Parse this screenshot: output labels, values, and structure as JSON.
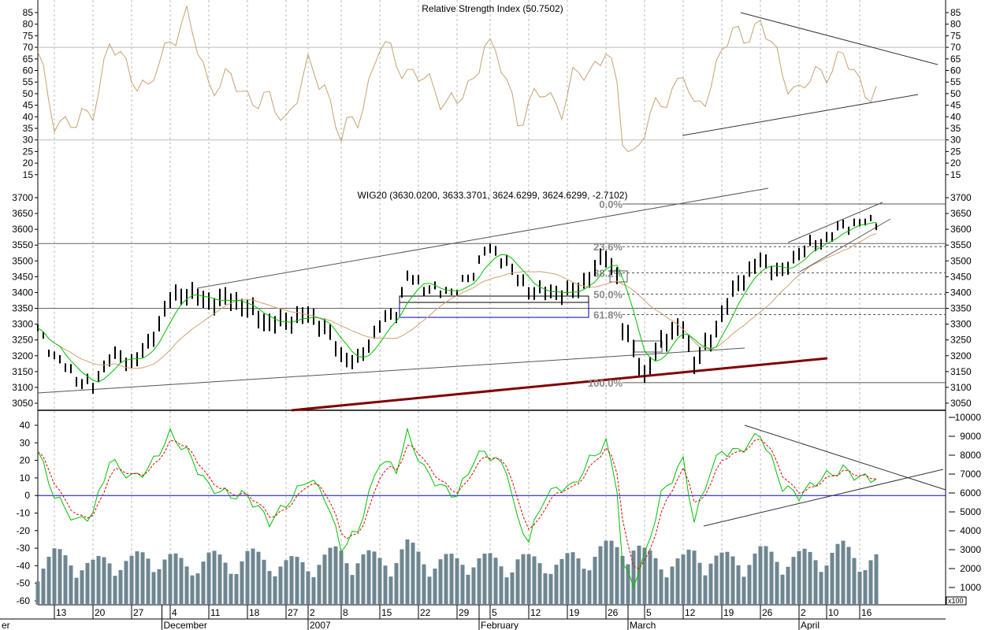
{
  "chart_data": [
    {
      "type": "line",
      "title": "Relative Strength Index (50.7502)",
      "yticks": [
        85,
        80,
        75,
        70,
        65,
        60,
        55,
        50,
        45,
        40,
        35,
        30,
        25,
        20,
        15
      ],
      "ylim": [
        12,
        88
      ],
      "levels": [
        70,
        30
      ],
      "days": [
        0,
        3,
        7,
        10,
        13,
        17,
        20,
        24,
        27,
        31,
        35,
        38,
        42,
        45,
        49,
        52,
        55,
        58,
        62,
        65,
        67,
        70,
        73,
        76,
        79,
        81,
        85,
        87,
        89,
        92,
        95,
        97,
        100,
        103,
        105,
        106,
        108,
        110,
        113,
        117,
        119,
        122,
        124,
        127,
        131,
        135,
        138,
        142,
        146,
        149,
        152
      ],
      "values": [
        65,
        40,
        35,
        45,
        70,
        60,
        50,
        75,
        82,
        55,
        55,
        50,
        45,
        40,
        60,
        55,
        30,
        40,
        70,
        65,
        60,
        55,
        50,
        45,
        55,
        75,
        55,
        40,
        45,
        50,
        45,
        55,
        60,
        70,
        50,
        30,
        25,
        35,
        45,
        60,
        40,
        55,
        70,
        75,
        80,
        60,
        50,
        60,
        65,
        55,
        50
      ],
      "color": "#c8a070"
    },
    {
      "type": "line",
      "title": "WIG20 (3630.0200, 3633.3701, 3624.6299, 3624.6299, -2.7102)",
      "yticks": [
        3700,
        3650,
        3600,
        3550,
        3500,
        3450,
        3400,
        3350,
        3300,
        3250,
        3200,
        3150,
        3100,
        3050
      ],
      "ylim": [
        3030,
        3720
      ],
      "days": [
        0,
        3,
        7,
        10,
        13,
        17,
        20,
        24,
        27,
        31,
        35,
        38,
        42,
        45,
        49,
        52,
        55,
        58,
        62,
        65,
        67,
        70,
        73,
        76,
        79,
        81,
        85,
        87,
        89,
        92,
        95,
        97,
        100,
        103,
        105,
        106,
        108,
        110,
        113,
        117,
        119,
        122,
        124,
        127,
        131,
        135,
        138,
        142,
        146,
        149,
        152
      ],
      "close": [
        3280,
        3200,
        3130,
        3100,
        3200,
        3180,
        3230,
        3380,
        3400,
        3370,
        3380,
        3350,
        3300,
        3310,
        3330,
        3290,
        3200,
        3180,
        3300,
        3340,
        3450,
        3420,
        3400,
        3410,
        3460,
        3540,
        3500,
        3440,
        3410,
        3400,
        3400,
        3400,
        3450,
        3520,
        3450,
        3280,
        3230,
        3130,
        3250,
        3290,
        3180,
        3250,
        3330,
        3430,
        3500,
        3460,
        3530,
        3560,
        3610,
        3620,
        3625
      ],
      "fibonacci": [
        {
          "label": "0.0%",
          "value": 3680
        },
        {
          "label": "23.6%",
          "value": 3545
        },
        {
          "label": "38.2%",
          "value": 3462
        },
        {
          "label": "50.0%",
          "value": 3395
        },
        {
          "label": "61.8%",
          "value": 3330
        },
        {
          "label": "100.0%",
          "value": 3115
        }
      ],
      "horizontal_lines": [
        3555,
        3350
      ],
      "series_colors": {
        "price": "#000000",
        "ma_short": "#00c000",
        "ma_long": "#d0a070",
        "support": "#800000"
      }
    },
    {
      "type": "line",
      "yticks_left": [
        40,
        30,
        20,
        10,
        0,
        -10,
        -20,
        -30,
        -40,
        -50,
        -60
      ],
      "ylim_left": [
        -63,
        43
      ],
      "yticks_right": [
        10000,
        9000,
        8000,
        7000,
        6000,
        5000,
        4000,
        3000,
        2000,
        1000
      ],
      "right_unit": "x100",
      "days": [
        0,
        3,
        7,
        10,
        13,
        17,
        20,
        24,
        27,
        31,
        35,
        38,
        42,
        45,
        49,
        52,
        55,
        58,
        62,
        65,
        67,
        70,
        73,
        76,
        79,
        81,
        85,
        87,
        89,
        92,
        95,
        97,
        100,
        103,
        105,
        106,
        108,
        110,
        113,
        117,
        119,
        122,
        124,
        127,
        131,
        135,
        138,
        142,
        146,
        149,
        152
      ],
      "oscillator": [
        25,
        0,
        -15,
        -10,
        20,
        10,
        15,
        35,
        25,
        5,
        0,
        0,
        -15,
        -5,
        10,
        0,
        -30,
        -20,
        20,
        15,
        35,
        15,
        5,
        0,
        20,
        25,
        15,
        -15,
        -25,
        0,
        5,
        5,
        20,
        30,
        5,
        -40,
        -50,
        -35,
        0,
        20,
        -15,
        15,
        25,
        25,
        35,
        5,
        0,
        10,
        15,
        10,
        10
      ],
      "volume": [
        2200,
        2600,
        2400,
        2100,
        2500,
        2300,
        2700,
        2400,
        2200,
        2500,
        2300,
        2600,
        2400,
        2200,
        2300,
        2500,
        2800,
        2600,
        2400,
        2700,
        3000,
        2500,
        2400,
        2300,
        2600,
        2400,
        2200,
        2500,
        2300,
        2400,
        2200,
        2500,
        2700,
        2900,
        3100,
        3400,
        3200,
        2600,
        2400,
        2300,
        2800,
        2600,
        2400,
        2500,
        2700,
        2600,
        2500,
        2700,
        2900,
        2600,
        2400
      ],
      "zero_line_color": "#0000ff",
      "oscillator_color": "#00c000",
      "signal_color": "#e00000",
      "volume_color": "#6e8690"
    }
  ],
  "x_axis": {
    "day_labels": [
      {
        "label": "13",
        "day": 3
      },
      {
        "label": "20",
        "day": 10
      },
      {
        "label": "27",
        "day": 17
      },
      {
        "label": "4",
        "day": 24
      },
      {
        "label": "11",
        "day": 31
      },
      {
        "label": "18",
        "day": 38
      },
      {
        "label": "27",
        "day": 45
      },
      {
        "label": "2",
        "day": 49
      },
      {
        "label": "8",
        "day": 55
      },
      {
        "label": "15",
        "day": 62
      },
      {
        "label": "22",
        "day": 69
      },
      {
        "label": "29",
        "day": 76
      },
      {
        "label": "5",
        "day": 82
      },
      {
        "label": "12",
        "day": 89
      },
      {
        "label": "19",
        "day": 96
      },
      {
        "label": "26",
        "day": 103
      },
      {
        "label": "5",
        "day": 110
      },
      {
        "label": "12",
        "day": 117
      },
      {
        "label": "19",
        "day": 124
      },
      {
        "label": "26",
        "day": 131
      },
      {
        "label": "2",
        "day": 138
      },
      {
        "label": "10",
        "day": 143
      },
      {
        "label": "16",
        "day": 149
      }
    ],
    "month_labels": [
      {
        "label": "er",
        "day": -7
      },
      {
        "label": "December",
        "day": 22.5
      },
      {
        "label": "2007",
        "day": 49
      },
      {
        "label": "February",
        "day": 80
      },
      {
        "label": "March",
        "day": 107
      },
      {
        "label": "April",
        "day": 138
      }
    ]
  }
}
